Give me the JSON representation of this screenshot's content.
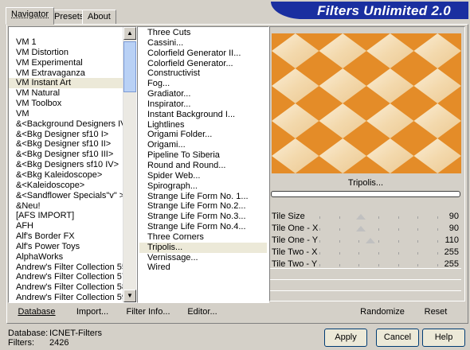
{
  "tabs": [
    "Navigator",
    "Presets",
    "About"
  ],
  "banner_title": "Filters Unlimited 2.0",
  "categories": [
    "VM 1",
    "VM Distortion",
    "VM Experimental",
    "VM Extravaganza",
    "VM Instant Art",
    "VM Natural",
    "VM Toolbox",
    "VM",
    "&<Background Designers IV>",
    "&<Bkg Designer sf10 I>",
    "&<Bkg Designer sf10 II>",
    "&<Bkg Designer sf10 III>",
    "&<Bkg Designers sf10 IV>",
    "&<Bkg Kaleidoscope>",
    "&<Kaleidoscope>",
    "&<Sandflower Specials\"v\" >",
    "&Neu!",
    "[AFS IMPORT]",
    "AFH",
    "Alf's Border FX",
    "Alf's Power Toys",
    "AlphaWorks",
    "Andrew's Filter Collection 55",
    "Andrew's Filter Collection 57",
    "Andrew's Filter Collection 58",
    "Andrew's Filter Collection 59"
  ],
  "categories_selected": 4,
  "filters": [
    "Three Cuts",
    "Cassini...",
    "Colorfield Generator II...",
    "Colorfield Generator...",
    "Constructivist",
    "Fog...",
    "Gradiator...",
    "Inspirator...",
    "Instant Background I...",
    "Lightlines",
    "Origami Folder...",
    "Origami...",
    "Pipeline To Siberia",
    "Round and Round...",
    "Spider Web...",
    "Spirograph...",
    "Strange Life Form No. 1...",
    "Strange Life Form No.2...",
    "Strange Life Form No.3...",
    "Strange Life Form No.4...",
    "Three Corners",
    "Tripolis...",
    "Vernissage...",
    "Wired"
  ],
  "filters_selected": 21,
  "filter_name_button": "Tripolis...",
  "sliders": [
    {
      "label": "Tile Size",
      "value": "90",
      "level": 0.35
    },
    {
      "label": "Tile One - X",
      "value": "90",
      "level": 0.35
    },
    {
      "label": "Tile One - Y",
      "value": "110",
      "level": 0.43
    },
    {
      "label": "Tile Two - X",
      "value": "255",
      "level": 1.0
    },
    {
      "label": "Tile Two - Y",
      "value": "255",
      "level": 1.0
    }
  ],
  "toolbar": {
    "database": "Database",
    "import": "Import...",
    "filter_info": "Filter Info...",
    "editor": "Editor...",
    "randomize": "Randomize",
    "reset": "Reset"
  },
  "status": {
    "database_label": "Database:",
    "database_value": "ICNET-Filters",
    "filters_label": "Filters:",
    "filters_value": "2426"
  },
  "dialog_buttons": {
    "apply": "Apply",
    "cancel": "Cancel",
    "help": "Help"
  },
  "colors": {
    "preview_dark": "#e48c28",
    "preview_light": "#f8e6c4",
    "banner": "#1a2fa0"
  }
}
